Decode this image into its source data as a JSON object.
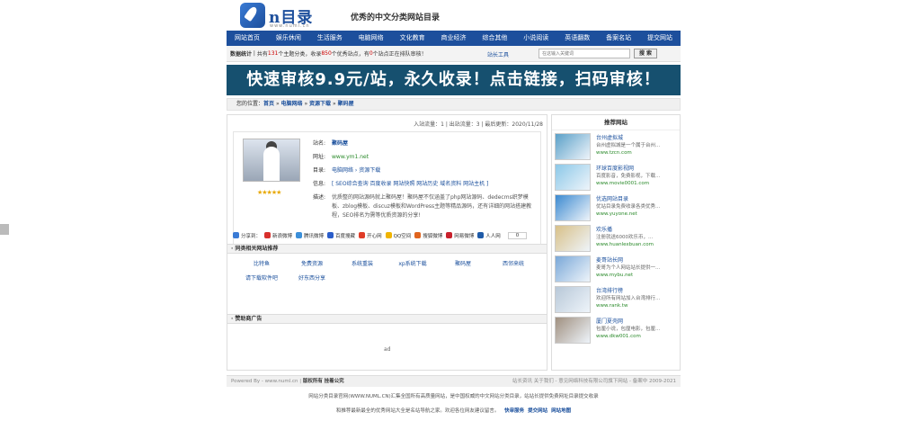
{
  "header": {
    "logo_text": "n目录",
    "logo_url": "www.numl.cn",
    "slogan": "优秀的中文分类网站目录"
  },
  "nav": [
    "网站首页",
    "娱乐休闲",
    "生活服务",
    "电脑网络",
    "文化教育",
    "商业经济",
    "综合其他",
    "小说阅读",
    "英语翻数",
    "备案名站",
    "提交网站"
  ],
  "stats": {
    "label": "数据统计",
    "text_a": "共有",
    "cat_count": "131",
    "text_b": "个主题分类，收录",
    "site_count": "850",
    "text_c": "个优秀站点，",
    "text_d": "有",
    "pending": "0",
    "text_e": "个站点正在排队审核！",
    "tool": "站长工具",
    "search_placeholder": "在这输入关键词",
    "search_button": "搜 索"
  },
  "banner": "快速审核9.9元/站，永久收录！点击链接，扫码审核！",
  "breadcrumb": {
    "prefix": "您的位置：",
    "items": [
      "首页",
      "电脑网络",
      "资源下载",
      "聚码屋"
    ],
    "sep": " » "
  },
  "flow": "入站流量：1 | 出站流量：3 | 最后更新：2020/11/28",
  "site": {
    "stars": "★★★★★",
    "name_label": "站名:",
    "name": "聚码屋",
    "url_label": "网址:",
    "url": "www.ym1.net",
    "cat_label": "目录:",
    "cat": "电脑网络 › 资源下载",
    "info_label": "信息:",
    "info": "[ SEO综合查询  百度收录  网站快照  网站历史  域名资料  网站主机 ]",
    "desc_label": "描述:",
    "desc": "优质整的网站源码就上聚码屋！聚码屋不仅涵盖了php网站源码、dedecms织梦模板、zblog模板、discuz模板和WordPress主题等精品源码，还有详细的网站搭建教程，SEO排名为需等优质资源的分享!"
  },
  "share": {
    "label": "分享到：",
    "items": [
      {
        "name": "新浪微博",
        "color": "#d8302c"
      },
      {
        "name": "腾讯微博",
        "color": "#3b8fd9"
      },
      {
        "name": "百度搜藏",
        "color": "#2b5dc9"
      },
      {
        "name": "开心网",
        "color": "#e03c28"
      },
      {
        "name": "QQ空间",
        "color": "#f0b400"
      },
      {
        "name": "搜狐微博",
        "color": "#e0641e"
      },
      {
        "name": "网易微博",
        "color": "#c8202c"
      },
      {
        "name": "人人网",
        "color": "#1f5ba8"
      }
    ],
    "count": "0"
  },
  "related": {
    "title": "· 同类相关网站推荐",
    "items": [
      "比特鱼",
      "免费资源",
      "系统重装",
      "xp系统下载",
      "聚码屋",
      "西邻来统",
      "请下载软件吧",
      "好东西分享"
    ]
  },
  "ads": {
    "title": "· 赞助商广告",
    "text": "ad"
  },
  "sidebar": {
    "title": "推荐网站",
    "items": [
      {
        "title": "台州虚拟城",
        "desc": "台州虚拟城是一个属于台州...",
        "url": "www.tzcn.com",
        "color": "#5aa0c8"
      },
      {
        "title": "环球百度影视网",
        "desc": "百度影音，免费影视，下载...",
        "url": "www.movie0001.com",
        "color": "#8cc8e8"
      },
      {
        "title": "优选网站目录",
        "desc": "优站目录免费收录各类优秀...",
        "url": "www.yuyone.net",
        "color": "#3c8ad0"
      },
      {
        "title": "欢乐播",
        "desc": "注册就送6000欢乐币，...",
        "url": "www.huanlexbuan.com",
        "color": "#d8c088"
      },
      {
        "title": "麦哥站长网",
        "desc": "麦哥为个人网站站长提供一...",
        "url": "www.mybu.net",
        "color": "#7aa8d8"
      },
      {
        "title": "台湾排行榜",
        "desc": "欢迎所有网站加入台湾排行...",
        "url": "www.rank.tw",
        "color": "#b8c8d8"
      },
      {
        "title": "厦门夏壳网",
        "desc": "包厘小说，包厘电影，包厘...",
        "url": "www.dkw001.com",
        "color": "#a09080"
      }
    ]
  },
  "footer": {
    "powered": "Powered By - www.numl.cn",
    "copyright": "版权所有",
    "contact": "挂着公究",
    "right": "站长资讯  关于我们 - 意见网络科技有限公司旗下网站 - 备案中  2009-2021",
    "line1": "网站分类目录官网(WWW.NUML.CN)汇集全国所有高质量网站，是中国权威的中文网站分类目录，站站长提供免费网址目录提交收录",
    "line2": "和推荐最新最全的优秀网站大全是名站导航之家。欢迎各位网友建议留言。",
    "links": [
      "快审服务",
      "提交网站",
      "网站地图"
    ]
  }
}
